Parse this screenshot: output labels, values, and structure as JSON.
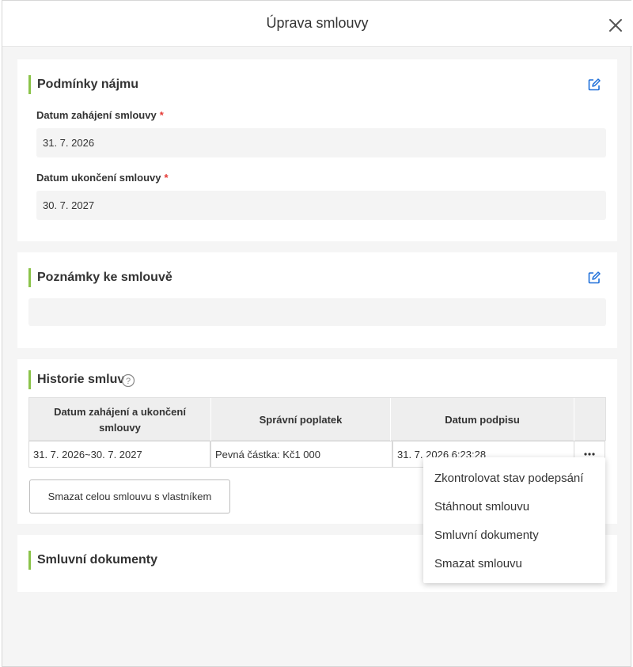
{
  "modal": {
    "title": "Úprava smlouvy"
  },
  "lease_terms": {
    "title": "Podmínky nájmu",
    "start_label": "Datum zahájení smlouvy",
    "start_value": "31. 7. 2026",
    "end_label": "Datum ukončení smlouvy",
    "end_value": "30. 7. 2027",
    "required_mark": "*"
  },
  "notes": {
    "title": "Poznámky ke smlouvě",
    "value": ""
  },
  "history": {
    "title": "Historie smluv",
    "columns": [
      "Datum zahájení a ukončení smlouvy",
      "Správní poplatek",
      "Datum podpisu"
    ],
    "rows": [
      {
        "period": "31. 7. 2026~30. 7. 2027",
        "fee": "Pevná částka: Kč1 000",
        "signed": "31. 7. 2026 6:23:28"
      }
    ],
    "delete_all_label": "Smazat celou smlouvu s vlastníkem"
  },
  "documents": {
    "title": "Smluvní dokumenty"
  },
  "row_menu": {
    "items": [
      "Zkontrolovat stav podepsání",
      "Stáhnout smlouvu",
      "Smluvní dokumenty",
      "Smazat smlouvu"
    ]
  },
  "colors": {
    "accent_bar": "#8bc34a",
    "edit_icon": "#1e6fd9",
    "required": "#e53935"
  },
  "icons": {
    "close": "close-icon",
    "edit": "edit-icon",
    "help": "help-icon",
    "more": "more-icon"
  }
}
